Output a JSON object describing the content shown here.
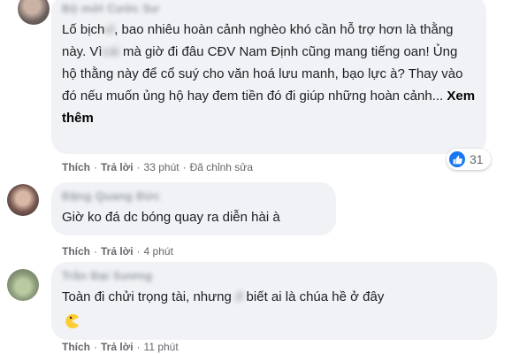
{
  "comments": [
    {
      "author": "Bộ mới Cước Sư",
      "text_before": "Lố bịch",
      "text_blur_1": "vl",
      "text_mid": ", bao nhiêu hoàn cảnh nghèo khó cần hỗ trợ hơn là thằng này. Vì",
      "text_blur_2": "cái",
      "text_after": " mà giờ đi đâu CĐV Nam Định cũng mang tiếng oan! Ủng hộ thằng này để cổ suý cho văn hoá lưu manh, bạo lực à? Thay vào đó nếu muốn ủng hộ hay đem tiền đó đi giúp những hoàn cảnh... ",
      "see_more": "Xem thêm",
      "like_label": "Thích",
      "reply_label": "Trả lời",
      "time": "33 phút",
      "edited": "Đã chỉnh sửa",
      "reaction_icon": "like-icon",
      "reaction_count": "31"
    },
    {
      "author": "Đặng Quang Đức",
      "text": "Giờ ko đá dc bóng quay ra diễn hài à",
      "like_label": "Thích",
      "reply_label": "Trả lời",
      "time": "4 phút"
    },
    {
      "author": "Trần Đại Sương",
      "text_before": "Toàn đi chửi trọng tài, nhưng",
      "text_blur": "đ",
      "text_after": " biết ai là chúa hề ở đây",
      "emoji": "pacman-emoji",
      "like_label": "Thích",
      "reply_label": "Trả lời",
      "time": "11 phút"
    }
  ],
  "colors": {
    "bubble": "#f0f2f5",
    "like_blue": "#1877f2",
    "meta_gray": "#65676b"
  }
}
